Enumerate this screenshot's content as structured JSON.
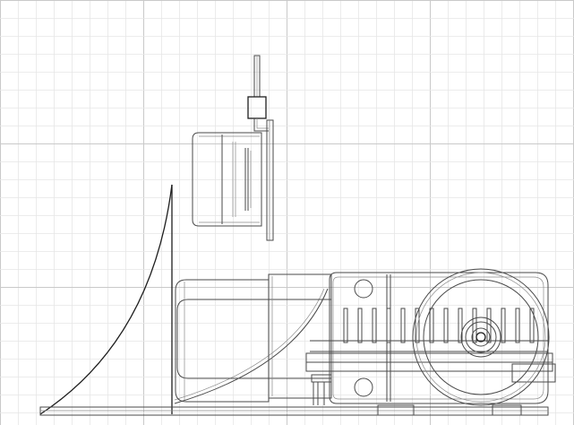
{
  "viewport": {
    "background": "#ffffff",
    "grid_minor_color": "#e6e6e6",
    "grid_major_color": "#c9c9c9",
    "line_color": "#4a4a4a",
    "dark_line_color": "#1e1e1e",
    "grid_visible": true
  },
  "drawing": {
    "view": "side-elevation",
    "parts": [
      "rod",
      "bracket-block",
      "cylinder-housing",
      "mounting-plate",
      "curved-gusset",
      "upright-post",
      "motor-body",
      "coupling",
      "gearbox-frame",
      "large-pulley",
      "base-plate"
    ]
  }
}
